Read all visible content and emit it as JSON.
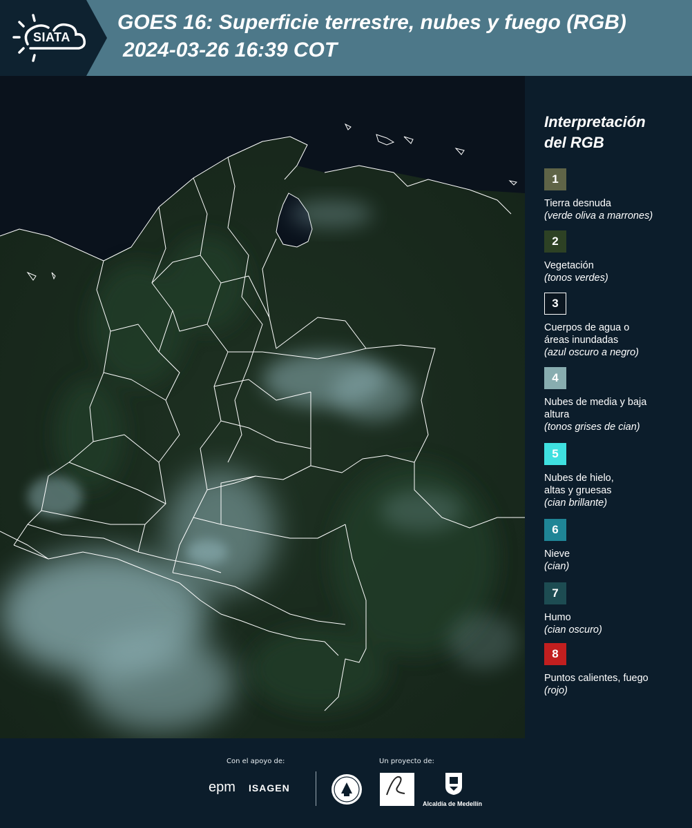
{
  "header": {
    "logo_text": "SIATA",
    "title": "GOES 16: Superficie terrestre, nubes y fuego (RGB)",
    "datetime": "2024-03-26 16:39 COT"
  },
  "legend": {
    "title_line1": "Interpretación",
    "title_line2": "del RGB",
    "items": [
      {
        "number": "1",
        "color": "#5f6447",
        "label": "Tierra desnuda",
        "note": "(verde oliva a marrones)"
      },
      {
        "number": "2",
        "color": "#2d4124",
        "label": "Vegetación",
        "note": "(tonos verdes)"
      },
      {
        "number": "3",
        "color": "#0b1620",
        "label": "Cuerpos de agua o áreas inundadas",
        "note": "(azul oscuro a negro)"
      },
      {
        "number": "4",
        "color": "#88adb0",
        "label": "Nubes de media y baja altura",
        "note": "(tonos grises de cian)"
      },
      {
        "number": "5",
        "color": "#3fe0e0",
        "label": "Nubes de hielo, altas y gruesas",
        "note": "(cian brillante)"
      },
      {
        "number": "6",
        "color": "#1f8596",
        "label": "Nieve",
        "note": "(cian)"
      },
      {
        "number": "7",
        "color": "#1d4c52",
        "label": "Humo",
        "note": "(cian oscuro)"
      },
      {
        "number": "8",
        "color": "#c21f1f",
        "label": "Puntos calientes, fuego",
        "note": "(rojo)"
      }
    ]
  },
  "footer": {
    "support_label": "Con el apoyo de:",
    "project_label": "Un proyecto de:",
    "sponsor_epm": "epm",
    "sponsor_isagen": "ISAGEN",
    "partner_alcaldia": "Alcaldía de Medellín"
  },
  "colors": {
    "header_bg": "#4d7889",
    "page_bg": "#0c1d2b",
    "land": "#1b2b1d",
    "ocean": "#0a121c",
    "cloud": "#8fb3b8",
    "border_line": "#ffffff"
  }
}
